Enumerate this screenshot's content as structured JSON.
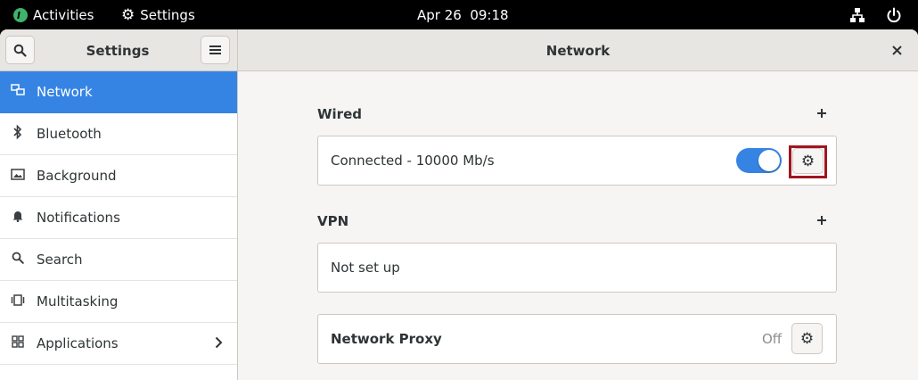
{
  "topbar": {
    "activities": "Activities",
    "app_name": "Settings",
    "clock": "Apr 26  09:18"
  },
  "header": {
    "left_title": "Settings",
    "right_title": "Network"
  },
  "sidebar": {
    "items": [
      {
        "label": "Network",
        "icon": "network-icon",
        "active": true
      },
      {
        "label": "Bluetooth",
        "icon": "bluetooth-icon"
      },
      {
        "label": "Background",
        "icon": "background-icon"
      },
      {
        "label": "Notifications",
        "icon": "bell-icon"
      },
      {
        "label": "Search",
        "icon": "search-icon"
      },
      {
        "label": "Multitasking",
        "icon": "multitasking-icon"
      },
      {
        "label": "Applications",
        "icon": "applications-icon",
        "has_arrow": true
      }
    ]
  },
  "content": {
    "wired": {
      "title": "Wired",
      "status": "Connected - 10000 Mb/s",
      "toggle_on": true
    },
    "vpn": {
      "title": "VPN",
      "status": "Not set up"
    },
    "proxy": {
      "title": "Network Proxy",
      "status": "Off"
    }
  },
  "colors": {
    "accent": "#3584e4",
    "highlight": "#a1141f"
  }
}
